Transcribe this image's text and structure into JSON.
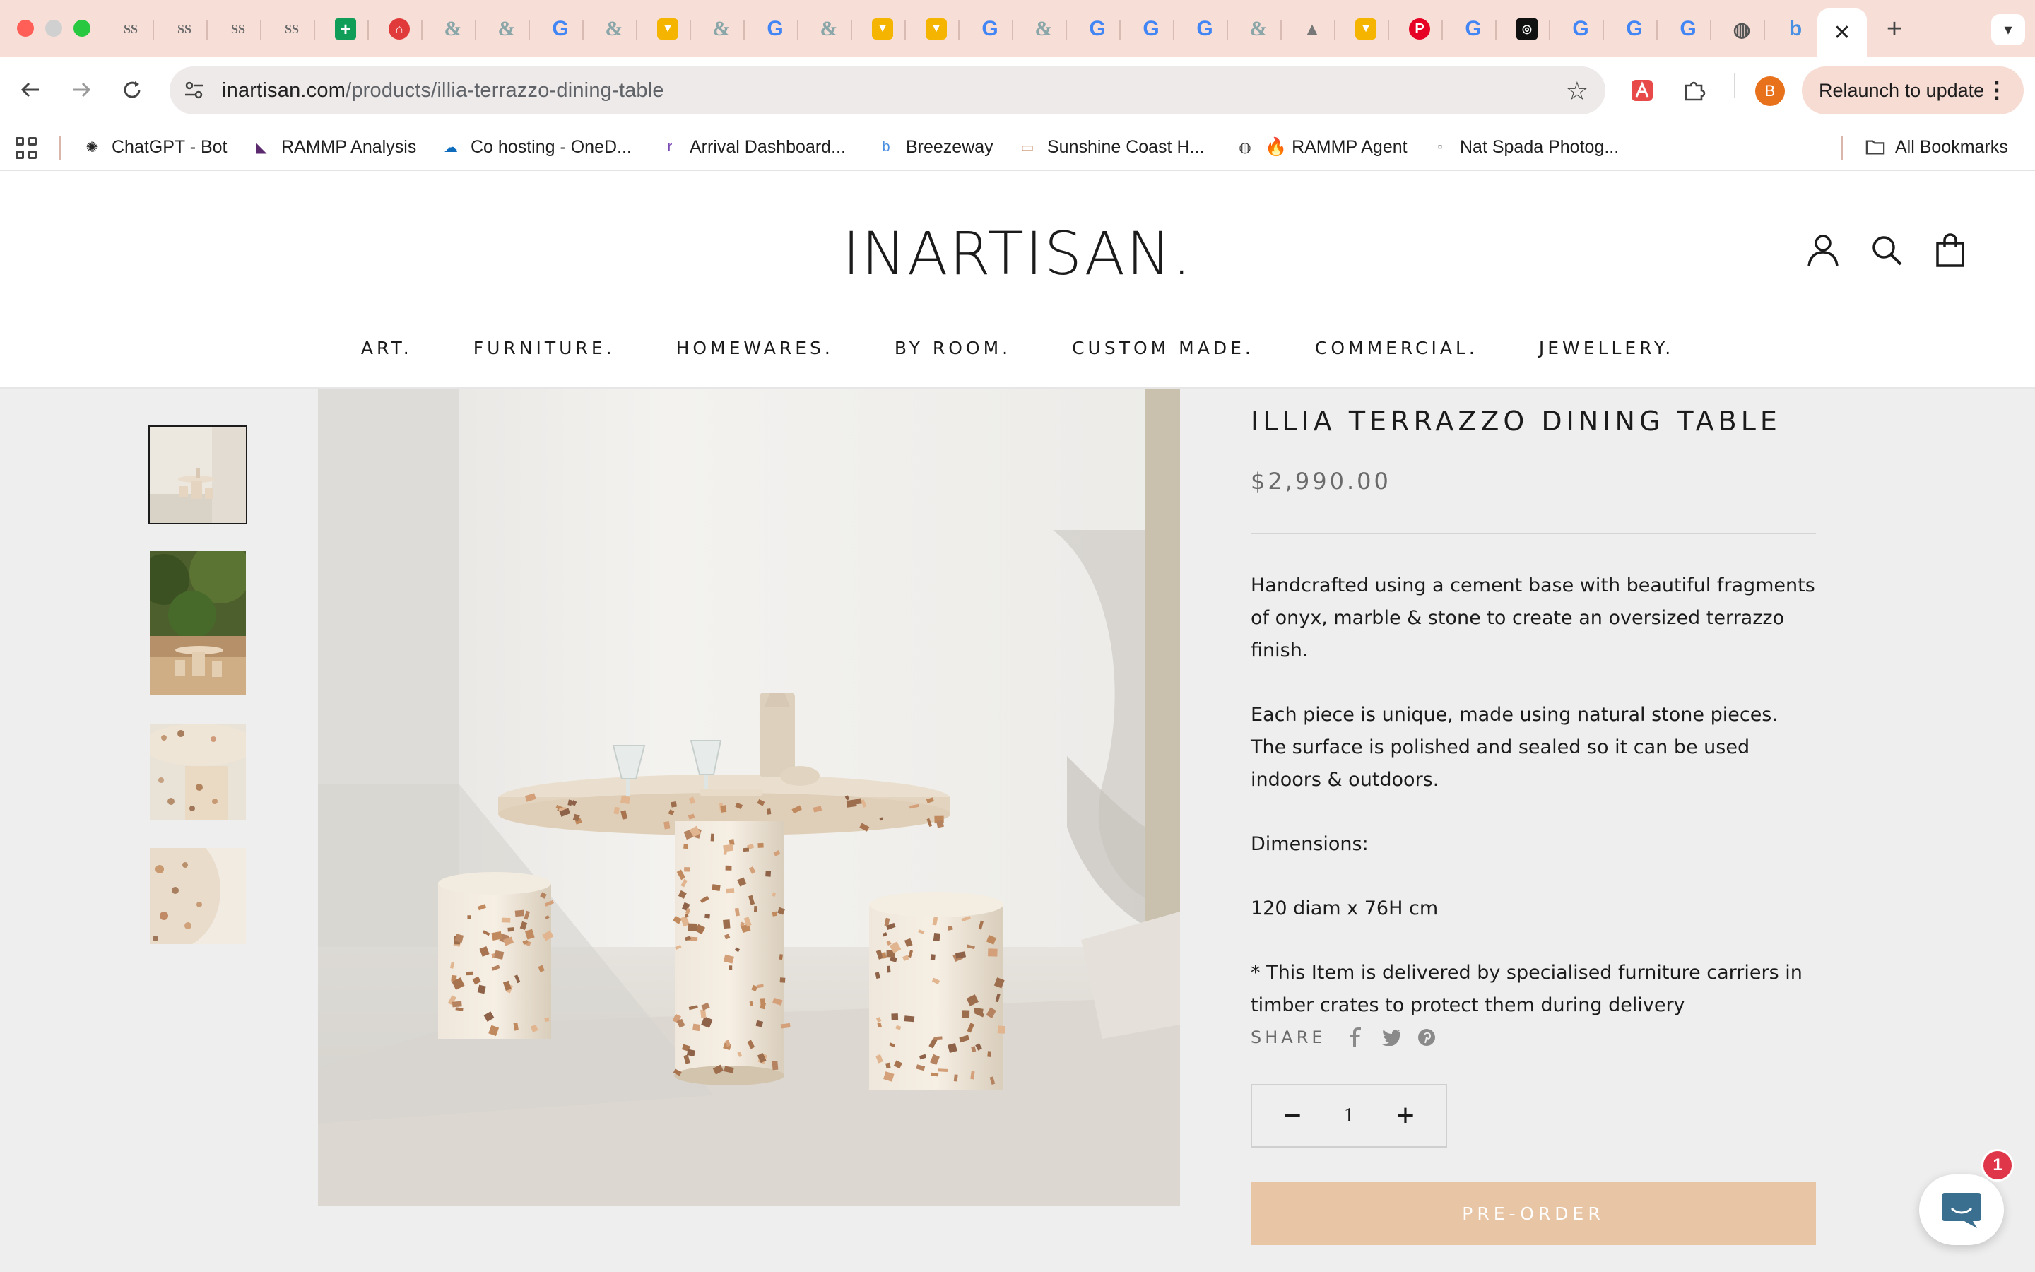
{
  "browser": {
    "url_host": "inartisan.com",
    "url_path": "/products/illia-terrazzo-dining-table",
    "relaunch_label": "Relaunch to update",
    "profile_initial": "B",
    "tabs": [
      {
        "icon": "ss-icon",
        "glyph": "SS"
      },
      {
        "icon": "ss-icon",
        "glyph": "SS"
      },
      {
        "icon": "ss-icon",
        "glyph": "SS"
      },
      {
        "icon": "ss-icon",
        "glyph": "SS"
      },
      {
        "icon": "sheets-icon",
        "glyph": "+"
      },
      {
        "icon": "red-house-icon",
        "glyph": "⌂"
      },
      {
        "icon": "ampersand-icon",
        "glyph": "&"
      },
      {
        "icon": "ampersand-icon",
        "glyph": "&"
      },
      {
        "icon": "google-icon",
        "glyph": "G"
      },
      {
        "icon": "ampersand-icon",
        "glyph": "&"
      },
      {
        "icon": "bag-icon",
        "glyph": "▼"
      },
      {
        "icon": "ampersand-icon",
        "glyph": "&"
      },
      {
        "icon": "google-icon",
        "glyph": "G"
      },
      {
        "icon": "ampersand-icon",
        "glyph": "&"
      },
      {
        "icon": "bag-icon",
        "glyph": "▼"
      },
      {
        "icon": "bag-icon",
        "glyph": "▼"
      },
      {
        "icon": "google-icon",
        "glyph": "G"
      },
      {
        "icon": "ampersand-icon",
        "glyph": "&"
      },
      {
        "icon": "google-icon",
        "glyph": "G"
      },
      {
        "icon": "google-icon",
        "glyph": "G"
      },
      {
        "icon": "google-icon",
        "glyph": "G"
      },
      {
        "icon": "ampersand-icon",
        "glyph": "&"
      },
      {
        "icon": "hat-icon",
        "glyph": "▲"
      },
      {
        "icon": "bag-icon",
        "glyph": "▼"
      },
      {
        "icon": "pinterest-icon",
        "glyph": "P"
      },
      {
        "icon": "google-icon",
        "glyph": "G"
      },
      {
        "icon": "dark-square-icon",
        "glyph": "◎"
      },
      {
        "icon": "google-icon",
        "glyph": "G"
      },
      {
        "icon": "google-icon",
        "glyph": "G"
      },
      {
        "icon": "google-icon",
        "glyph": "G"
      },
      {
        "icon": "globe-icon",
        "glyph": "◍"
      },
      {
        "icon": "breezeway-icon",
        "glyph": "b"
      }
    ]
  },
  "bookmarks": {
    "items": [
      {
        "label": "ChatGPT - Bot",
        "icon": "chatgpt-icon",
        "glyph": "✺",
        "color": "#222222"
      },
      {
        "label": "RAMMP Analysis",
        "icon": "rammp-icon",
        "glyph": "◣",
        "color": "#5b2a6e"
      },
      {
        "label": "Co hosting - OneD...",
        "icon": "onedrive-icon",
        "glyph": "☁",
        "color": "#0f6cbd"
      },
      {
        "label": "Arrival Dashboard...",
        "icon": "arrival-icon",
        "glyph": "r",
        "color": "#7b4ab5"
      },
      {
        "label": "Breezeway",
        "icon": "breezeway-icon",
        "glyph": "b",
        "color": "#4a90e2"
      },
      {
        "label": "Sunshine Coast H...",
        "icon": "sunshine-icon",
        "glyph": "▭",
        "color": "#c98f6a"
      },
      {
        "label": "🔥 RAMMP Agent",
        "icon": "globe-icon",
        "glyph": "◍",
        "color": "#333333"
      },
      {
        "label": "Nat Spada Photog...",
        "icon": "photo-icon",
        "glyph": "▫",
        "color": "#888888"
      }
    ],
    "all_bookmarks": "All Bookmarks"
  },
  "site": {
    "logo": "INARTISAN.",
    "nav": [
      "ART.",
      "FURNITURE.",
      "HOMEWARES.",
      "BY ROOM.",
      "CUSTOM MADE.",
      "COMMERCIAL.",
      "JEWELLERY."
    ]
  },
  "product": {
    "title": "ILLIA TERRAZZO DINING TABLE",
    "price": "$2,990.00",
    "description": [
      "Handcrafted using a cement base with beautiful fragments of onyx, marble & stone to create an oversized terrazzo finish.",
      "Each piece is unique, made using natural stone pieces.  The surface is polished and sealed so it can be used indoors & outdoors.",
      "Dimensions:",
      "120 diam x 76H cm",
      "* This Item is delivered by specialised furniture carriers in timber crates to protect them during delivery"
    ],
    "share_label": "SHARE",
    "quantity": "1",
    "preorder_label": "PRE-ORDER"
  },
  "chat": {
    "badge_count": "1"
  },
  "colors": {
    "tabstrip": "#f7dfd8",
    "preorder": "#e8c5a4",
    "price": "#6a6a6a",
    "badge": "#e0364a"
  }
}
